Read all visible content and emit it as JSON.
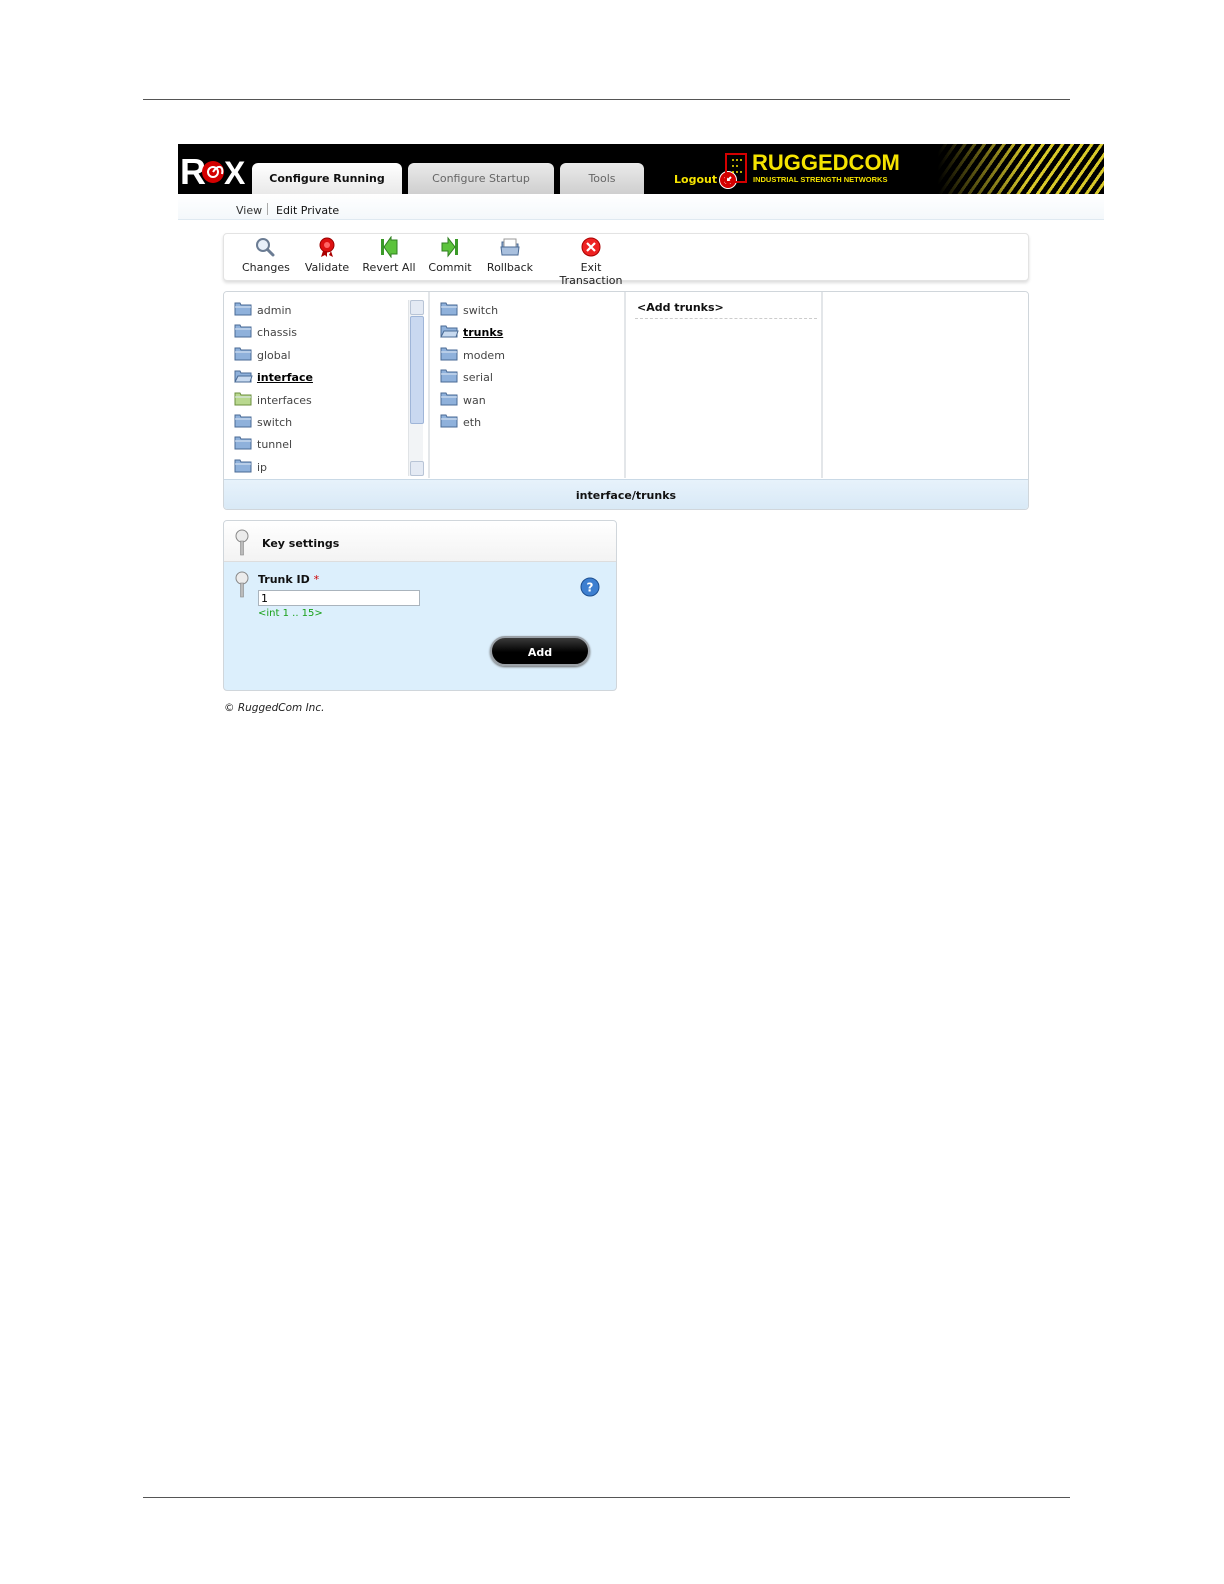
{
  "header": {
    "logo_text": "ROX",
    "tabs": [
      {
        "label": "Configure Running",
        "active": true
      },
      {
        "label": "Configure Startup",
        "active": false
      },
      {
        "label": "Tools",
        "active": false
      }
    ],
    "logout_label": "Logout",
    "brand_name": "RUGGEDCOM",
    "brand_tagline": "INDUSTRIAL STRENGTH NETWORKS",
    "accent_color": "#f5e300"
  },
  "subnav": {
    "view_label": "View",
    "edit_label": "Edit Private"
  },
  "toolbar": {
    "items": [
      {
        "label": "Changes",
        "icon": "magnifier-icon"
      },
      {
        "label": "Validate",
        "icon": "validate-seal-icon"
      },
      {
        "label": "Revert All",
        "icon": "revert-icon"
      },
      {
        "label": "Commit",
        "icon": "commit-icon"
      },
      {
        "label": "Rollback",
        "icon": "rollback-icon"
      },
      {
        "label": "Exit Transaction",
        "icon": "exit-icon"
      }
    ]
  },
  "browser": {
    "column1": [
      "admin",
      "chassis",
      "global",
      "interface",
      "interfaces",
      "switch",
      "tunnel",
      "ip"
    ],
    "column1_selected": "interface",
    "column2": [
      "switch",
      "trunks",
      "modem",
      "serial",
      "wan",
      "eth"
    ],
    "column2_selected": "trunks",
    "column3_add": "<Add trunks>",
    "path": "interface/trunks"
  },
  "key_settings": {
    "title": "Key settings",
    "field_label": "Trunk ID",
    "required_marker": "*",
    "field_value": "1",
    "field_hint": "<int 1 .. 15>",
    "add_label": "Add"
  },
  "footer": {
    "copyright": "© RuggedCom Inc."
  }
}
